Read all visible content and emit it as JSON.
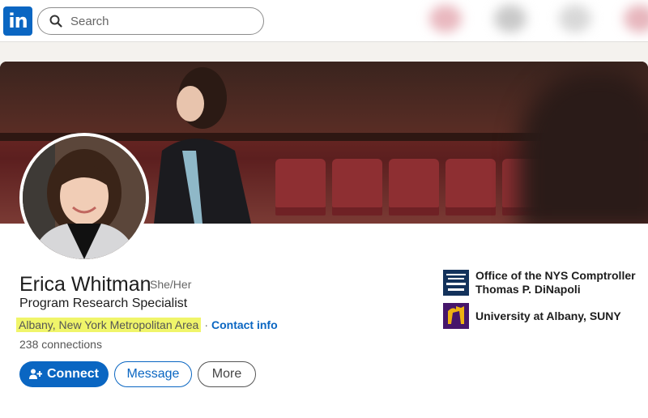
{
  "nav": {
    "logo_text": "in",
    "search_placeholder": "Search"
  },
  "profile": {
    "name": "Erica Whitman",
    "pronouns": "She/Her",
    "headline": "Program Research Specialist",
    "location": "Albany, New York Metropolitan Area",
    "separator": "·",
    "contact_label": "Contact info",
    "connections": "238 connections"
  },
  "actions": {
    "connect_label": "Connect",
    "message_label": "Message",
    "more_label": "More"
  },
  "organizations": [
    {
      "line1": "Office of the NYS Comptroller",
      "line2": "Thomas P. DiNapoli",
      "logo_icon": "nys-comptroller-logo"
    },
    {
      "line1": "University at Albany, SUNY",
      "line2": "",
      "logo_icon": "ualbany-logo"
    }
  ],
  "colors": {
    "brand": "#0a66c2",
    "highlight": "#f0f56a"
  }
}
